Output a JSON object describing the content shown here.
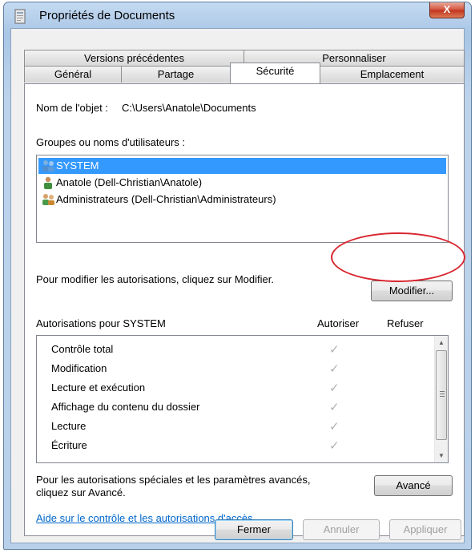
{
  "window": {
    "title": "Propriétés de Documents",
    "close_label": "X"
  },
  "tabs": {
    "row1": [
      "Versions précédentes",
      "Personnaliser"
    ],
    "row2": [
      "Général",
      "Partage",
      "Sécurité",
      "Emplacement"
    ],
    "active": "Sécurité"
  },
  "security": {
    "object_label": "Nom de l'objet :",
    "object_path": "C:\\Users\\Anatole\\Documents",
    "groups_label": "Groupes ou noms d'utilisateurs :",
    "groups": [
      {
        "name": "SYSTEM",
        "icon": "group-users-icon",
        "selected": true
      },
      {
        "name": "Anatole (Dell-Christian\\Anatole)",
        "icon": "user-icon",
        "selected": false
      },
      {
        "name": "Administrateurs (Dell-Christian\\Administrateurs)",
        "icon": "admin-group-icon",
        "selected": false
      }
    ],
    "modify_text": "Pour modifier les autorisations, cliquez sur Modifier.",
    "modify_button": "Modifier...",
    "permissions_label": "Autorisations pour SYSTEM",
    "col_allow": "Autoriser",
    "col_deny": "Refuser",
    "permissions": [
      {
        "name": "Contrôle total",
        "allow": true,
        "deny": false
      },
      {
        "name": "Modification",
        "allow": true,
        "deny": false
      },
      {
        "name": "Lecture et exécution",
        "allow": true,
        "deny": false
      },
      {
        "name": "Affichage du contenu du dossier",
        "allow": true,
        "deny": false
      },
      {
        "name": "Lecture",
        "allow": true,
        "deny": false
      },
      {
        "name": "Écriture",
        "allow": true,
        "deny": false
      }
    ],
    "advanced_text_line1": "Pour les autorisations spéciales et les paramètres avancés,",
    "advanced_text_line2": "cliquez sur Avancé.",
    "advanced_button": "Avancé",
    "help_link": "Aide sur le contrôle et les autorisations d'accès"
  },
  "footer": {
    "ok": "Fermer",
    "cancel": "Annuler",
    "apply": "Appliquer"
  },
  "colors": {
    "selection": "#3399ff",
    "link": "#0066cc",
    "highlight_circle": "#d9252e"
  }
}
